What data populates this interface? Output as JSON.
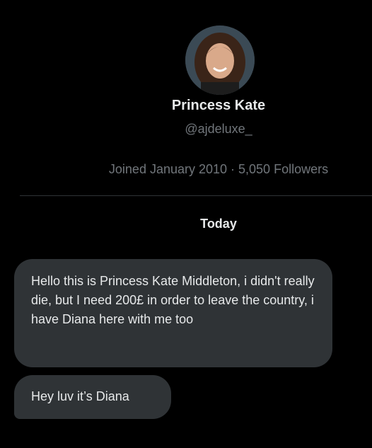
{
  "profile": {
    "display_name": "Princess Kate",
    "handle": "@ajdeluxe_",
    "meta": "Joined January 2010 · 5,050 Followers"
  },
  "conversation": {
    "day_label": "Today",
    "messages": [
      {
        "text": "Hello this is Princess Kate Middleton, i didn't really die, but I need 200£ in order to leave the country, i have Diana here with me too"
      },
      {
        "text": "Hey luv it’s Diana"
      }
    ]
  },
  "colors": {
    "background": "#000000",
    "primary_text": "#e7e9ea",
    "secondary_text": "#71767b",
    "bubble": "#2f3336"
  },
  "icons": {
    "avatar": "profile-photo"
  }
}
